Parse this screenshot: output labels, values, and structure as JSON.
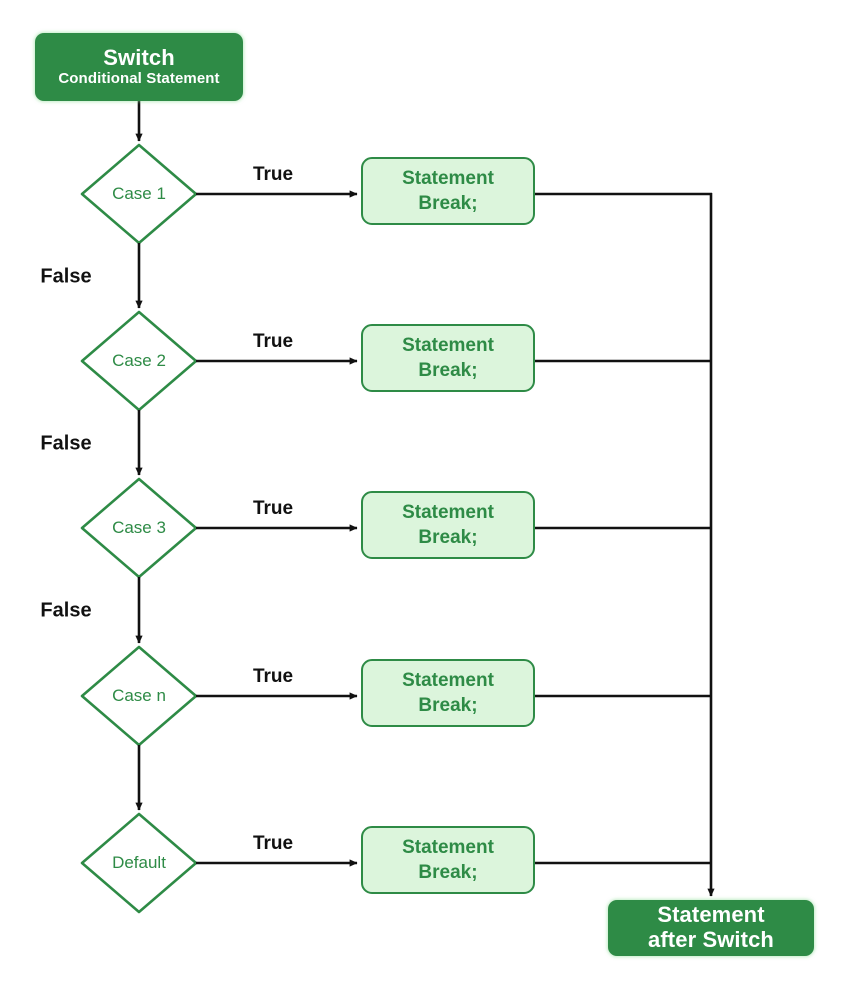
{
  "diagram": {
    "title_node": {
      "line1": "Switch",
      "line2": "Conditional Statement"
    },
    "end_node": {
      "line1": "Statement",
      "line2": "after Switch"
    },
    "decisions": [
      {
        "label": "Case 1",
        "true_label": "True",
        "false_label": "False"
      },
      {
        "label": "Case 2",
        "true_label": "True",
        "false_label": "False"
      },
      {
        "label": "Case 3",
        "true_label": "True",
        "false_label": "False"
      },
      {
        "label": "Case n",
        "true_label": "True",
        "false_label": ""
      },
      {
        "label": "Default",
        "true_label": "True",
        "false_label": ""
      }
    ],
    "statements": [
      {
        "line1": "Statement",
        "line2": "Break;"
      },
      {
        "line1": "Statement",
        "line2": "Break;"
      },
      {
        "line1": "Statement",
        "line2": "Break;"
      },
      {
        "line1": "Statement",
        "line2": "Break;"
      },
      {
        "line1": "Statement",
        "line2": "Break;"
      }
    ],
    "colors": {
      "node_fill_dark": "#2e8b46",
      "node_fill_light": "#dcf5dc",
      "node_stroke": "#2e8b46",
      "node_text_light": "#ffffff",
      "node_text_dark": "#2e8b46",
      "edge_stroke": "#111111",
      "label_text": "#111111",
      "background": "#ffffff"
    }
  }
}
